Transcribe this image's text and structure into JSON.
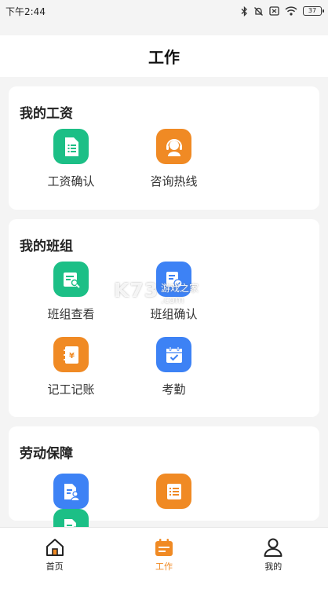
{
  "status_bar": {
    "time": "下午2:44",
    "battery": "37"
  },
  "header": {
    "title": "工作"
  },
  "sections": [
    {
      "title": "我的工资",
      "items": [
        {
          "label": "工资确认",
          "icon": "document-list-icon",
          "color": "#1cbf86"
        },
        {
          "label": "咨询热线",
          "icon": "headset-icon",
          "color": "#f08a24"
        }
      ]
    },
    {
      "title": "我的班组",
      "items": [
        {
          "label": "班组查看",
          "icon": "view-document-icon",
          "color": "#1cbf86"
        },
        {
          "label": "班组确认",
          "icon": "confirm-document-icon",
          "color": "#3d82f5"
        },
        {
          "label": "记工记账",
          "icon": "ledger-icon",
          "color": "#f08a24"
        },
        {
          "label": "考勤",
          "icon": "calendar-check-icon",
          "color": "#3d82f5"
        }
      ]
    },
    {
      "title": "劳动保障",
      "items": [
        {
          "label": "",
          "icon": "document-person-icon",
          "color": "#3d82f5"
        },
        {
          "label": "",
          "icon": "list-icon",
          "color": "#f08a24"
        },
        {
          "label": "",
          "icon": "document-money-icon",
          "color": "#1cbf86"
        }
      ]
    }
  ],
  "watermark": {
    "main": "K73",
    "sub": "游戏之家",
    "sub2": ".com"
  },
  "bottom_nav": [
    {
      "label": "首页",
      "icon": "home-icon"
    },
    {
      "label": "工作",
      "icon": "calendar-icon",
      "active": true
    },
    {
      "label": "我的",
      "icon": "user-icon"
    }
  ],
  "colors": {
    "accent": "#f08a24",
    "green": "#1cbf86",
    "blue": "#3d82f5"
  }
}
